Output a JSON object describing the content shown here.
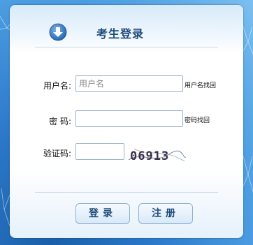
{
  "header": {
    "title": "考生登录",
    "icon": "down-arrow-circle-icon"
  },
  "form": {
    "username": {
      "label": "用户名:",
      "placeholder": "用户名",
      "value": "",
      "link": "用户名找回"
    },
    "password": {
      "label": "密 码:",
      "value": "",
      "link": "密码找回"
    },
    "captcha": {
      "label": "验证码:",
      "value": "",
      "image_text": "06913"
    }
  },
  "buttons": {
    "login": "登录",
    "register": "注册"
  },
  "colors": {
    "title": "#1e4c7a",
    "accent": "#2b78c9",
    "border": "#9cb5cc"
  }
}
